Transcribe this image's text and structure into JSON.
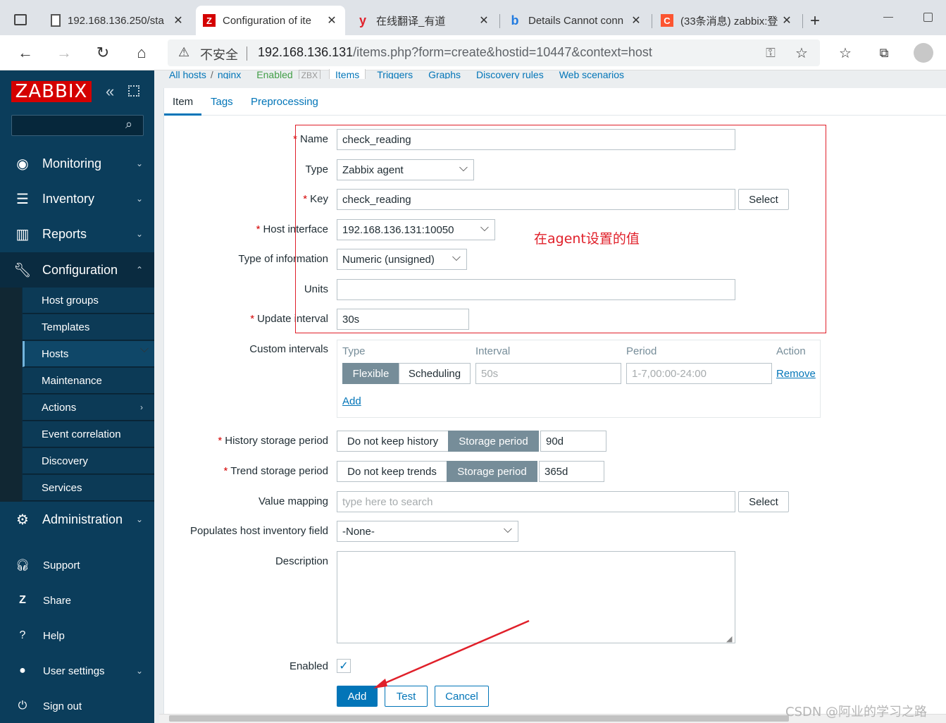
{
  "browser": {
    "tabs": [
      {
        "title": "192.168.136.250/sta",
        "favicon": "file-icon"
      },
      {
        "title": "Configuration of ite",
        "favicon": "zabbix-icon",
        "active": true
      },
      {
        "title": "在线翻译_有道",
        "favicon": "youdao-icon"
      },
      {
        "title": "Details Cannot conn",
        "favicon": "bing-icon"
      },
      {
        "title": "(33条消息) zabbix:登",
        "favicon": "csdn-icon"
      }
    ],
    "insecure_label": "不安全",
    "url_host": "192.168.136.131",
    "url_path": "/items.php?form=create&hostid=10447&context=host"
  },
  "sidebar": {
    "logo": "ZABBIX",
    "search_placeholder": "",
    "menu": [
      {
        "label": "Monitoring",
        "icon": "eye-icon"
      },
      {
        "label": "Inventory",
        "icon": "list-icon"
      },
      {
        "label": "Reports",
        "icon": "chart-icon"
      },
      {
        "label": "Configuration",
        "icon": "wrench-icon"
      }
    ],
    "submenu": [
      "Host groups",
      "Templates",
      "Hosts",
      "Maintenance",
      "Actions",
      "Event correlation",
      "Discovery",
      "Services"
    ],
    "administration": "Administration",
    "lower": [
      {
        "label": "Support",
        "icon": "headset-icon"
      },
      {
        "label": "Share",
        "icon": "share-icon"
      },
      {
        "label": "Help",
        "icon": "help-icon"
      },
      {
        "label": "User settings",
        "icon": "user-icon"
      },
      {
        "label": "Sign out",
        "icon": "power-icon"
      }
    ]
  },
  "breadcrumb": {
    "all_hosts": "All hosts",
    "sep": "/",
    "host": "nginx",
    "status": "Enabled",
    "zbx": "ZBX",
    "items": "Items",
    "triggers": "Triggers",
    "graphs": "Graphs",
    "discovery": "Discovery rules",
    "web": "Web scenarios"
  },
  "form_tabs": [
    "Item",
    "Tags",
    "Preprocessing"
  ],
  "fields": {
    "name_label": "Name",
    "name_value": "check_reading",
    "type_label": "Type",
    "type_value": "Zabbix agent",
    "key_label": "Key",
    "key_value": "check_reading",
    "select_label": "Select",
    "host_interface_label": "Host interface",
    "host_interface_value": "192.168.136.131:10050",
    "type_info_label": "Type of information",
    "type_info_value": "Numeric (unsigned)",
    "units_label": "Units",
    "units_value": "",
    "update_label": "Update interval",
    "update_value": "30s",
    "custom_label": "Custom intervals",
    "ci_type": "Type",
    "ci_interval": "Interval",
    "ci_period": "Period",
    "ci_action": "Action",
    "ci_flexible": "Flexible",
    "ci_scheduling": "Scheduling",
    "ci_interval_ph": "50s",
    "ci_period_ph": "1-7,00:00-24:00",
    "ci_remove": "Remove",
    "ci_add": "Add",
    "history_label": "History storage period",
    "history_no": "Do not keep history",
    "history_storage": "Storage period",
    "history_value": "90d",
    "trend_label": "Trend storage period",
    "trend_no": "Do not keep trends",
    "trend_storage": "Storage period",
    "trend_value": "365d",
    "valuemap_label": "Value mapping",
    "valuemap_ph": "type here to search",
    "inventory_label": "Populates host inventory field",
    "inventory_value": "-None-",
    "description_label": "Description",
    "enabled_label": "Enabled"
  },
  "buttons": {
    "add": "Add",
    "test": "Test",
    "cancel": "Cancel"
  },
  "annotation_note": "在agent设置的值",
  "watermark": "CSDN @阿业的学习之路",
  "colors": {
    "sidebar": "#0b3d5b",
    "accent": "#0275b8",
    "logo": "#d40000",
    "annotation": "#e0202a"
  }
}
